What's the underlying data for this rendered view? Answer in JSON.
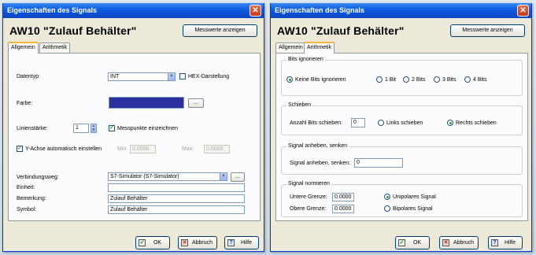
{
  "window_title": "Eigenschaften des Signals",
  "close_glyph": "✕",
  "signal_name": "AW10 \"Zulauf Behälter\"",
  "show_values_button": "Messwerte anzeigen",
  "tabs": [
    "Allgemein",
    "Arithmetik"
  ],
  "buttons": {
    "ok": "OK",
    "cancel": "Abbruch",
    "help": "Hilfe"
  },
  "button_icons": {
    "ok": "check-icon",
    "cancel": "x-icon",
    "help": "question-icon"
  },
  "colors": {
    "title_bar": "#0a4fd3",
    "signal_color": "#2b2fa0",
    "active_tab_accent": "#f8b33a"
  },
  "general": {
    "datatype_label": "Datentyp:",
    "datatype_value": "INT",
    "hex_label": "HEX-Darstellung",
    "hex_checked": false,
    "color_label": "Farbe:",
    "browse_button": "...",
    "line_width_label": "Linienstärke:",
    "line_width_value": "1",
    "draw_points_label": "Messpunkte einzeichnen",
    "draw_points_checked": true,
    "y_axis_auto_label": "Y-Achse automatisch einstellen",
    "y_axis_auto_checked": true,
    "min_label": "Min:",
    "min_value": "0.0000",
    "max_label": "Max:",
    "max_value": "0.0000",
    "connection_label": "Verbindungsweg:",
    "connection_value": "S7-Simulator (S7-Simulator)",
    "unit_label": "Einheit:",
    "unit_value": "",
    "remark_label": "Bemerkung:",
    "remark_value": "Zulauf Behälter",
    "symbol_label": "Symbol:",
    "symbol_value": "Zulauf Behälter"
  },
  "arithmetic": {
    "ignore_bits": {
      "title": "Bits ignorieren",
      "options": [
        "Keine Bits ignorieren",
        "1 Bit",
        "2 Bits",
        "3 Bits",
        "4 Bits"
      ],
      "selected": "Keine Bits ignorieren"
    },
    "shift": {
      "title": "Schieben",
      "count_label": "Anzahl Bits schieben:",
      "count_value": "0",
      "options": [
        "Links schieben",
        "Rechts schieben"
      ],
      "selected": "Rechts schieben"
    },
    "raise": {
      "title": "Signal anheben, senken",
      "label": "Signal anheben, senken:",
      "value": "0"
    },
    "normalize": {
      "title": "Signal normieren",
      "lower_label": "Untere Grenze:",
      "lower_value": "0.0000",
      "upper_label": "Obere Grenze:",
      "upper_value": "0.0000",
      "options": [
        "Unipolares Signal",
        "Bipolares Signal"
      ],
      "selected": "Unipolares Signal"
    }
  }
}
